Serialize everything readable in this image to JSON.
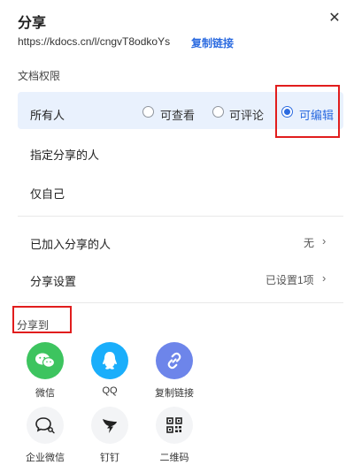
{
  "dialog": {
    "title": "分享",
    "url": "https://kdocs.cn/l/cngvT8odkoYs",
    "copy_link_label": "复制链接"
  },
  "permissions": {
    "section_label": "文档权限",
    "owner_label": "所有人",
    "options": [
      {
        "label": "可查看",
        "selected": false
      },
      {
        "label": "可评论",
        "selected": false
      },
      {
        "label": "可编辑",
        "selected": true
      }
    ],
    "specified_people": "指定分享的人",
    "only_me": "仅自己"
  },
  "settings": {
    "joined_label": "已加入分享的人",
    "joined_value": "无",
    "share_settings_label": "分享设置",
    "share_settings_value": "已设置1项"
  },
  "share_to": {
    "label": "分享到",
    "items": [
      {
        "label": "微信",
        "color": "#3dc45f",
        "icon": "wechat-icon"
      },
      {
        "label": "QQ",
        "color": "#1aaefb",
        "icon": "qq-icon"
      },
      {
        "label": "复制链接",
        "color": "#6d85ea",
        "icon": "link-icon"
      },
      {
        "label": "企业微信",
        "color": "#f3f4f6",
        "icon": "work-wechat-icon"
      },
      {
        "label": "钉钉",
        "color": "#f3f4f6",
        "icon": "dingtalk-icon"
      },
      {
        "label": "二维码",
        "color": "#f3f4f6",
        "icon": "qrcode-icon"
      }
    ]
  }
}
